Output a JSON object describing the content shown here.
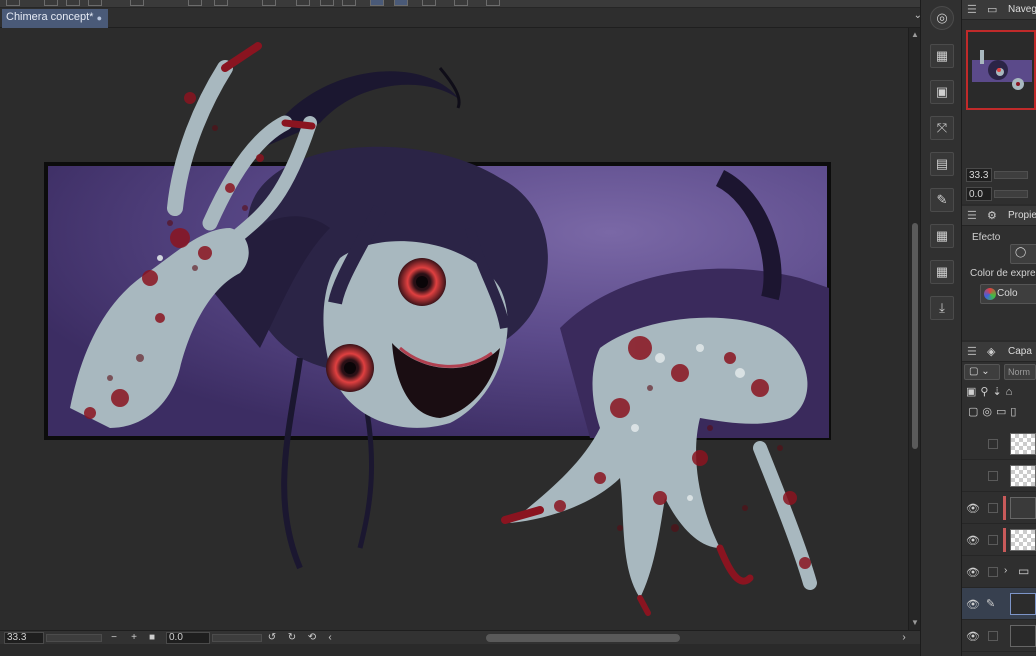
{
  "document": {
    "tab_title": "Chimera concept*",
    "modified_indicator": "●"
  },
  "canvas": {
    "zoom_value": "33.3",
    "rotation_value": "0.0"
  },
  "navigator": {
    "title": "Naveg",
    "zoom_value": "33.3",
    "rotation_value": "0.0"
  },
  "properties": {
    "title": "Propie",
    "effect_label": "Efecto",
    "expression_color_label": "Color de expre",
    "color_button_label": "Colo"
  },
  "layers": {
    "title": "Capa",
    "blend_mode": "Norm",
    "rows": [
      {
        "visible": false,
        "thumb": "checker"
      },
      {
        "visible": false,
        "thumb": "checker"
      },
      {
        "visible": true,
        "thumb": "dark",
        "marked": true
      },
      {
        "visible": true,
        "thumb": "checker",
        "marked": true
      },
      {
        "visible": true,
        "thumb": "folder"
      },
      {
        "visible": true,
        "thumb": "selected"
      },
      {
        "visible": true,
        "thumb": "dark"
      }
    ]
  },
  "colors": {
    "accent_tab": "#4a5a78",
    "nav_frame": "#c02a2a",
    "panel_purple": "#5b4a8a",
    "blood": "#8a1420",
    "eye_red": "#e04040",
    "skin": "#a8b8bf"
  }
}
